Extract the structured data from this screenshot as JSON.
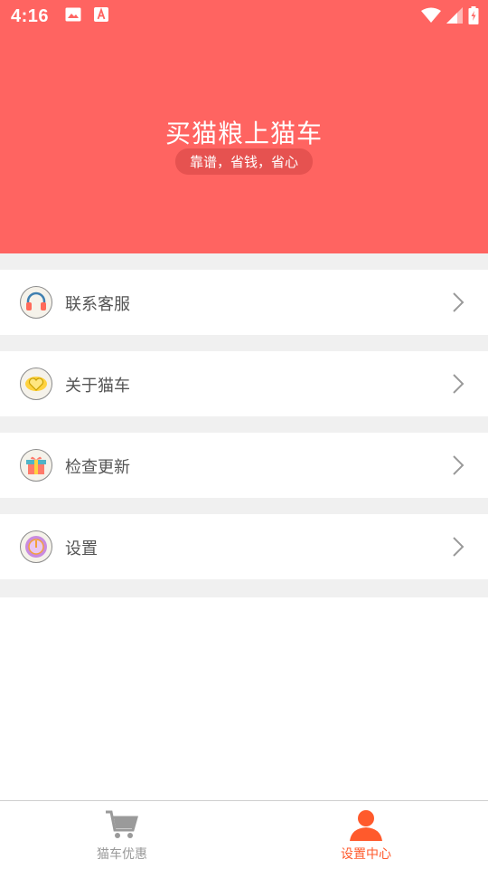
{
  "status_bar": {
    "time": "4:16"
  },
  "hero": {
    "title": "买猫粮上猫车",
    "slogan": "靠谱，省钱，省心"
  },
  "menu": [
    {
      "label": "联系客服",
      "icon": "headphones-icon"
    },
    {
      "label": "关于猫车",
      "icon": "heart-icon"
    },
    {
      "label": "检查更新",
      "icon": "gift-box-icon"
    },
    {
      "label": "设置",
      "icon": "gauge-icon"
    }
  ],
  "tabs": [
    {
      "label": "猫车优惠",
      "icon": "cart-icon",
      "active": false,
      "color": "#9a9a9a"
    },
    {
      "label": "设置中心",
      "icon": "user-icon",
      "active": true,
      "color": "#ff5a2c"
    }
  ],
  "colors": {
    "brand": "#ff6461",
    "active_tab": "#ff5a2c",
    "inactive_tab": "#9a9a9a"
  }
}
